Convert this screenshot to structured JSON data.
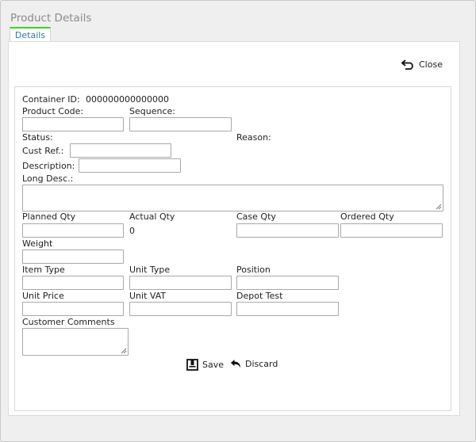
{
  "window": {
    "title": "Product Details"
  },
  "tabs": [
    {
      "label": "Details"
    }
  ],
  "toolbar": {
    "close_label": "Close"
  },
  "form": {
    "container_id_label": "Container ID:",
    "container_id_value": "000000000000000",
    "product_code_label": "Product Code:",
    "product_code_value": "",
    "sequence_label": "Sequence:",
    "sequence_value": "",
    "status_label": "Status:",
    "reason_label": "Reason:",
    "cust_ref_label": "Cust Ref.:",
    "cust_ref_value": "",
    "description_label": "Description:",
    "description_value": "",
    "long_desc_label": "Long Desc.:",
    "long_desc_value": "",
    "planned_qty_label": "Planned Qty",
    "planned_qty_value": "",
    "actual_qty_label": "Actual Qty",
    "actual_qty_value": "0",
    "case_qty_label": "Case Qty",
    "case_qty_value": "",
    "ordered_qty_label": "Ordered Qty",
    "ordered_qty_value": "",
    "weight_label": "Weight",
    "weight_value": "",
    "item_type_label": "Item Type",
    "item_type_value": "",
    "unit_type_label": "Unit Type",
    "unit_type_value": "",
    "position_label": "Position",
    "position_value": "",
    "unit_price_label": "Unit Price",
    "unit_price_value": "",
    "unit_vat_label": "Unit VAT",
    "unit_vat_value": "",
    "depot_test_label": "Depot Test",
    "depot_test_value": "",
    "customer_comments_label": "Customer Comments",
    "customer_comments_value": ""
  },
  "actions": {
    "save_label": "Save",
    "discard_label": "Discard"
  },
  "icons": {
    "close": "undo-arrow-icon",
    "save": "save-icon",
    "discard": "reply-arrow-icon"
  },
  "colors": {
    "tab_accent": "#3bd41b",
    "tab_text": "#2f74c0",
    "title_text": "#8c8c8c"
  }
}
